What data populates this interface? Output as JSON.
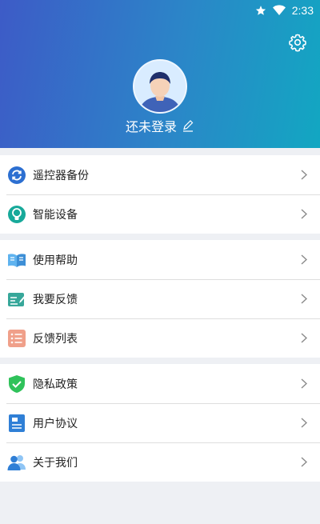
{
  "status_bar": {
    "time": "2:33"
  },
  "profile": {
    "login_text": "还未登录"
  },
  "groups": [
    {
      "items": [
        {
          "label": "遥控器备份"
        },
        {
          "label": "智能设备"
        }
      ]
    },
    {
      "items": [
        {
          "label": "使用帮助"
        },
        {
          "label": "我要反馈"
        },
        {
          "label": "反馈列表"
        }
      ]
    },
    {
      "items": [
        {
          "label": "隐私政策"
        },
        {
          "label": "用户协议"
        },
        {
          "label": "关于我们"
        }
      ]
    }
  ],
  "colors": {
    "header_gradient_start": "#3d5bc7",
    "header_gradient_end": "#12a7c2",
    "page_background": "#eef0f4",
    "item_text": "#222222"
  }
}
